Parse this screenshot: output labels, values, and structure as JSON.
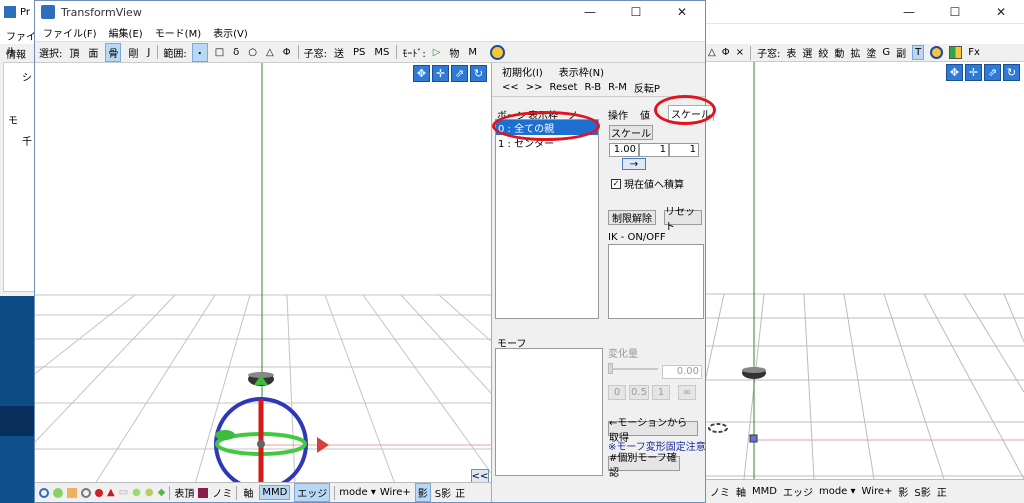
{
  "back_left": {
    "title": "Pr",
    "menu": "ファイル",
    "tab": "情報",
    "panel_chars": [
      "シ",
      "モ",
      "千"
    ]
  },
  "back_right": {
    "toolbar": [
      "△",
      "Φ",
      "×",
      "子窓:",
      "表",
      "選",
      "絞",
      "動",
      "拡",
      "塗",
      "G",
      "副",
      "T",
      "Fx"
    ],
    "status": [
      "ノミ",
      "軸",
      "MMD",
      "エッジ",
      "mode ▾",
      "Wire+",
      "影",
      "S影",
      "正"
    ]
  },
  "main": {
    "title": "TransformView",
    "menu": [
      "ファイル(F)",
      "編集(E)",
      "モード(M)",
      "表示(V)"
    ],
    "toolbar": {
      "select_label": "選択:",
      "select_items": [
        "頂",
        "面",
        "骨",
        "剛",
        "J"
      ],
      "range_label": "範囲:",
      "range_items": [
        "・",
        "□",
        "δ",
        "○",
        "△",
        "Φ"
      ],
      "child_label": "子窓:",
      "child_items": [
        "送",
        "PS",
        "MS"
      ],
      "mode_label": "ﾓｰﾄﾞ:",
      "mode_items": [
        "▷",
        "物",
        "M"
      ]
    },
    "status": [
      "表頂",
      "ノミ",
      "軸",
      "MMD",
      "エッジ",
      "mode ▾",
      "Wire+",
      "影",
      "S影",
      "正"
    ],
    "collapse_btn": "<<"
  },
  "panel": {
    "menu": [
      "初期化(I)",
      "表示枠(N)"
    ],
    "buttons": [
      "<<",
      ">>",
      "Reset",
      "R-B",
      "R-M",
      "反転P"
    ],
    "list_tabs": [
      "ボーン",
      "表示枠",
      "ノ"
    ],
    "bone_list": [
      "0 : 全ての親",
      "1 : センター"
    ],
    "tabs": [
      "操作",
      "値",
      "スケール"
    ],
    "scale_btn": "スケール",
    "scale_values": [
      "1.00",
      "1",
      "1"
    ],
    "arrow_btn": "→",
    "accumulate_label": "現在値へ積算",
    "accumulate_checked": true,
    "limit_btn": "制限解除",
    "reset_btn": "リセット",
    "ik_label": "IK - ON/OFF",
    "morph_label": "モーフ",
    "change_label": "変化量",
    "change_value": "0.00",
    "morph_value_btns": [
      "0",
      "0.5",
      "1",
      "∞"
    ],
    "from_motion_btn": "←モーションから取得",
    "note": "※モーフ変形固定注意",
    "individual_btn": "#個別モーフ確認"
  },
  "colors": {
    "oval": "#e0141e",
    "selection": "#1f6fd0",
    "accent": "#2e7ad6"
  }
}
